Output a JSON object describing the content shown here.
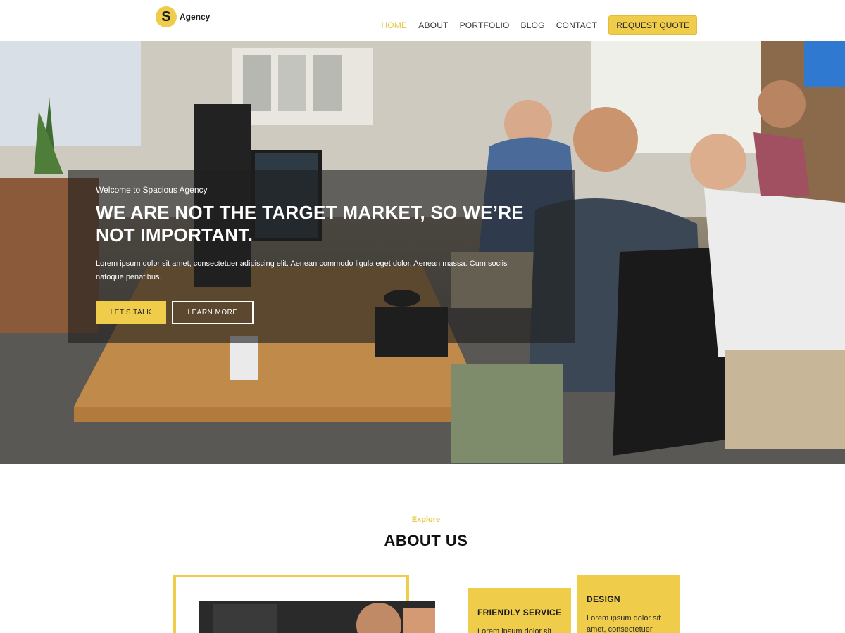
{
  "brand": {
    "initial": "S",
    "name": "Agency"
  },
  "nav": {
    "items": [
      {
        "label": "HOME",
        "active": true
      },
      {
        "label": "ABOUT",
        "active": false
      },
      {
        "label": "PORTFOLIO",
        "active": false
      },
      {
        "label": "BLOG",
        "active": false
      },
      {
        "label": "CONTACT",
        "active": false
      }
    ],
    "quote_button": "REQUEST QUOTE"
  },
  "hero": {
    "welcome": "Welcome to Spacious Agency",
    "title": "WE ARE NOT THE TARGET MARKET, SO WE’RE NOT IMPORTANT.",
    "description": "Lorem ipsum dolor sit amet, consectetuer adipiscing elit. Aenean commodo ligula eget dolor. Aenean massa. Cum sociis natoque penatibus.",
    "primary_button": "LET'S TALK",
    "secondary_button": "LEARN MORE"
  },
  "about": {
    "eyebrow": "Explore",
    "title": "ABOUT US",
    "cards": [
      {
        "title": "FRIENDLY SERVICE",
        "text": "Lorem ipsum dolor sit amet, consectetuer"
      },
      {
        "title": "DESIGN",
        "text": "Lorem ipsum dolor sit amet, consectetuer"
      }
    ]
  },
  "colors": {
    "accent": "#efcd4b",
    "nav_active": "#e6c84a",
    "text_dark": "#111111"
  }
}
